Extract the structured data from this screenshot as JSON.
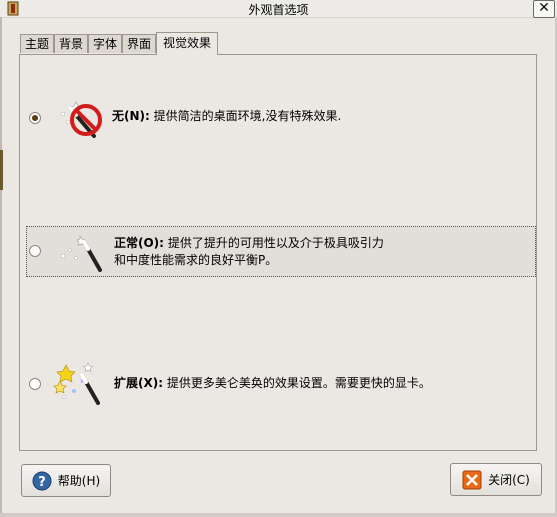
{
  "window": {
    "title": "外观首选项",
    "close_glyph": "✕"
  },
  "tabs": [
    {
      "label": "主题",
      "active": false
    },
    {
      "label": "背景",
      "active": false
    },
    {
      "label": "字体",
      "active": false
    },
    {
      "label": "界面",
      "active": false
    },
    {
      "label": "视觉效果",
      "active": true
    }
  ],
  "effects": {
    "selected": "none",
    "options": [
      {
        "id": "none",
        "name": "无(N):",
        "description": "提供简洁的桌面环境,没有特殊效果.",
        "icon": "magic-wand-disabled-icon"
      },
      {
        "id": "normal",
        "name": "正常(O):",
        "description_line1": "提供了提升的可用性以及介于极具吸引力",
        "description_line2": "和中度性能需求的良好平衡P。",
        "icon": "magic-wand-icon"
      },
      {
        "id": "extra",
        "name": "扩展(X):",
        "description": "提供更多美仑美奂的效果设置。需要更快的显卡。",
        "icon": "magic-wand-sparkles-icon"
      }
    ]
  },
  "buttons": {
    "help": {
      "label": "帮助(H)",
      "icon": "help-icon"
    },
    "close": {
      "label": "关闭(C)",
      "icon": "close-icon"
    }
  },
  "colors": {
    "background": "#ebe8e3",
    "tab_inactive": "#dcd8d1",
    "radio_dot": "#5a3a10",
    "no_sign": "#d21d1d",
    "help_blue": "#3465a4",
    "close_orange": "#e66a17"
  }
}
